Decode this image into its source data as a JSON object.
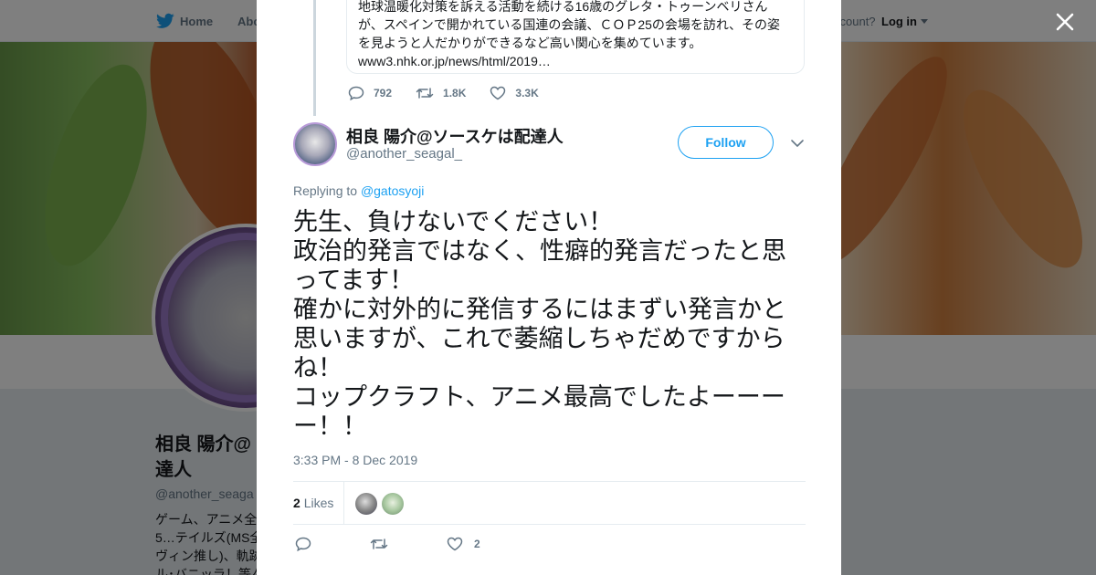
{
  "nav": {
    "home": "Home",
    "about": "Abo",
    "account_question": "ccount?",
    "login": "Log in"
  },
  "background_profile": {
    "name": "相良 陽介@\n達人",
    "handle": "@another_seaga",
    "bio_lines": [
      "ゲーム、アニメ全",
      "5…テイルズ(MS全",
      "ヴィン推し)、軌跡",
      "ル･バニッラ！等々"
    ]
  },
  "quoted_tweet": {
    "text": "地球温暖化対策を訴える活動を続ける16歳のグレタ・トゥーンベリさんが、スペインで開かれている国連の会議、ＣＯＰ25の会場を訪れ、その姿を見ようと人だかりができるなど高い関心を集めています。",
    "link": "www3.nhk.or.jp/news/html/2019…",
    "replies": "792",
    "retweets": "1.8K",
    "likes": "3.3K"
  },
  "tweet": {
    "name": "相良 陽介@ソースケは配達人",
    "handle": "@another_seagal_",
    "follow_label": "Follow",
    "replying_prefix": "Replying to ",
    "replying_to": "@gatosyoji",
    "text": "先生、負けないでください！\n政治的発言ではなく、性癖的発言だったと思ってます！\n確かに対外的に発信するにはまずい発言かと思いますが、これで萎縮しちゃだめですからね！\nコップクラフト、アニメ最高でしたよーーーー！！",
    "timestamp": "3:33 PM - 8 Dec 2019",
    "likes_count": "2",
    "likes_label": "Likes",
    "action_like_count": "2"
  },
  "colors": {
    "accent": "#1da1f2",
    "text": "#14171a",
    "muted": "#657786",
    "border": "#e6ecf0"
  }
}
